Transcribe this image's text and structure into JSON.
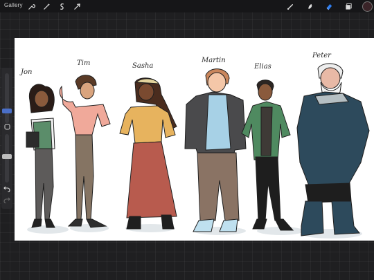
{
  "toolbar": {
    "gallery_label": "Gallery",
    "left_tools": [
      "wrench-icon",
      "magic-wand-icon",
      "selection-icon",
      "transform-icon"
    ],
    "right_tools": [
      "brush-icon",
      "smudge-icon",
      "eraser-icon",
      "layers-icon"
    ],
    "color_swatch": "#3a2428",
    "active_tool": "eraser-icon",
    "accent": "#2f7ff2"
  },
  "sidebar": {
    "size_slider_level": 0.25,
    "opacity_slider_level": 0.55,
    "buttons": [
      "modify-button",
      "undo-icon",
      "redo-icon"
    ]
  },
  "characters": [
    {
      "name": "Jon"
    },
    {
      "name": "Tim"
    },
    {
      "name": "Sasha"
    },
    {
      "name": "Martin"
    },
    {
      "name": "Elias"
    },
    {
      "name": "Peter"
    }
  ]
}
